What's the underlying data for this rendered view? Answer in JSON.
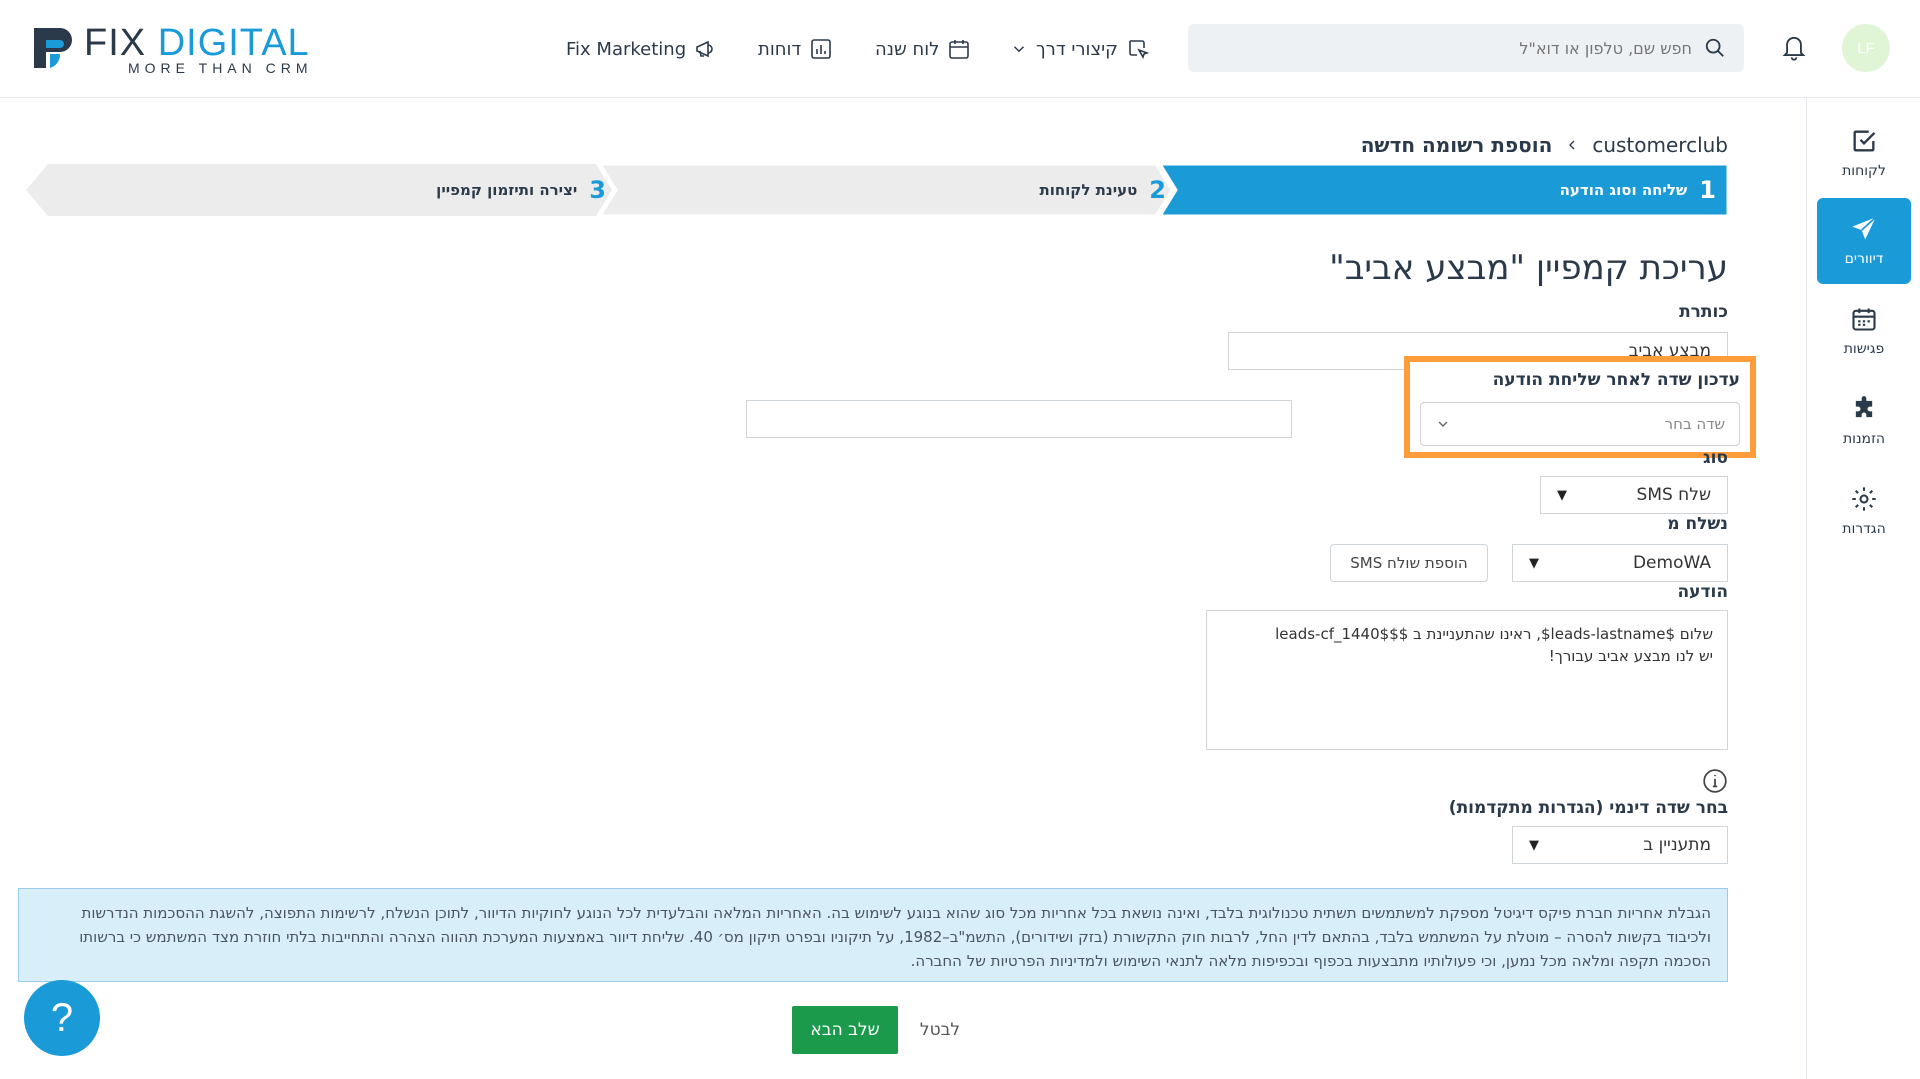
{
  "colors": {
    "accent": "#1a9bd7",
    "highlight": "#ff9d3b",
    "success": "#1a9a4a",
    "step_inactive": "#ececec"
  },
  "logo": {
    "word1": "FIX",
    "word2": "DIGITAL",
    "tagline": "MORE THAN CRM"
  },
  "topnav": {
    "fix_marketing": "Fix Marketing",
    "reports": "דוחות",
    "calendar": "לוח שנה",
    "shortcuts": "קיצורי דרך"
  },
  "search": {
    "placeholder": "חפש שם, טלפון או דוא\"ל"
  },
  "user": {
    "initials": "LF"
  },
  "sidebar": {
    "items": [
      {
        "label": "לקוחות",
        "icon": "checkbox-icon"
      },
      {
        "label": "דיוורים",
        "icon": "send-icon"
      },
      {
        "label": "פגישות",
        "icon": "calendar-icon"
      },
      {
        "label": "הזמנות",
        "icon": "puzzle-icon"
      },
      {
        "label": "הגדרות",
        "icon": "gear-icon"
      }
    ]
  },
  "breadcrumb": {
    "root": "customerclub",
    "current": "הוספת רשומה חדשה"
  },
  "steps": [
    {
      "num": "1",
      "label": "שליחה וסוג הודעה"
    },
    {
      "num": "2",
      "label": "טעינת לקוחות"
    },
    {
      "num": "3",
      "label": "יצירה ותיזמון קמפיין"
    }
  ],
  "form": {
    "title": "עריכת קמפיין \"מבצע אביב\"",
    "subject_label": "כותרת",
    "subject_value": "מבצע אביב",
    "update_field_label": "עדכון שדה לאחר שליחת הודעה",
    "update_field_placeholder": "שדה בחר",
    "type_label": "סוג",
    "type_value": "שלח SMS",
    "sender_label": "נשלח מ",
    "sender_value": "DemoWA",
    "add_sender_button": "הוספת שולח SMS",
    "message_label": "הודעה",
    "message_value": "שלום $leads-lastname$, ראינו שהתעניינת ב $$leads-cf_1440$\nיש לנו מבצע אביב עבורך!",
    "dynamic_label": "בחר שדה דינמי (הגדרות מתקדמות)",
    "dynamic_value": "מתעניין ב"
  },
  "disclaimer": "הגבלת אחריות חברת פיקס דיגיטל מספקת למשתמשים תשתית טכנולוגית בלבד, ואינה נושאת בכל אחריות מכל סוג שהוא בנוגע לשימוש בה. האחריות המלאה והבלעדית לכל הנוגע לחוקיות הדיוור, לתוכן הנשלח, לרשימות התפוצה, להשגת ההסכמות הנדרשות ולכיבוד בקשות להסרה – מוטלת על המשתמש בלבד, בהתאם לדין החל, לרבות חוק התקשורת (בזק ושידורים), התשמ\"ב–1982, על תיקוניו ובפרט תיקון מס׳ 40. שליחת דיוור באמצעות המערכת תהווה הצהרה והתחייבות בלתי חוזרת מצד המשתמש כי ברשותו הסכמה תקפה ומלאה מכל נמען, וכי פעולותיו מתבצעות בכפוף ובכפיפות מלאה לתנאי השימוש ולמדיניות הפרטיות של החברה.",
  "buttons": {
    "next": "שלב הבא",
    "cancel": "לבטל",
    "help": "?"
  }
}
